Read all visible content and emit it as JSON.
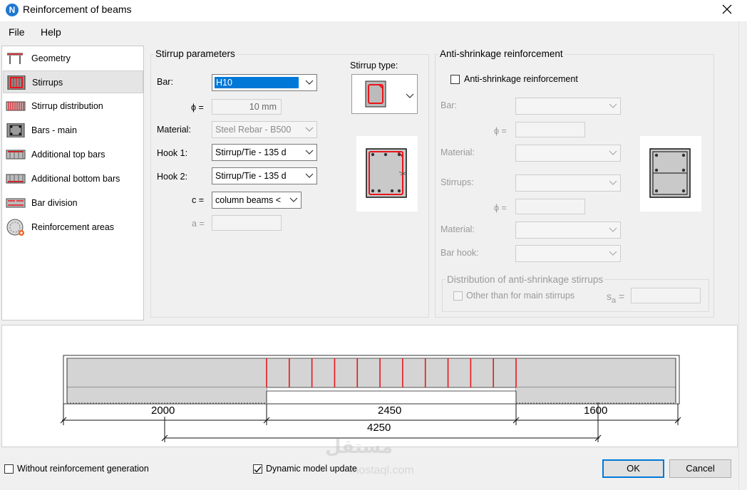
{
  "window": {
    "title": "Reinforcement of beams",
    "app_icon_letter": "N"
  },
  "menu": {
    "file": "File",
    "help": "Help"
  },
  "nav": [
    {
      "label": "Geometry",
      "icon": "geometry-icon"
    },
    {
      "label": "Stirrups",
      "icon": "stirrups-icon",
      "selected": true
    },
    {
      "label": "Stirrup distribution",
      "icon": "stirrup-distribution-icon"
    },
    {
      "label": "Bars - main",
      "icon": "bars-main-icon"
    },
    {
      "label": "Additional top bars",
      "icon": "additional-top-bars-icon"
    },
    {
      "label": "Additional bottom bars",
      "icon": "additional-bottom-bars-icon"
    },
    {
      "label": "Bar division",
      "icon": "bar-division-icon"
    },
    {
      "label": "Reinforcement areas",
      "icon": "reinforcement-areas-icon"
    }
  ],
  "stirrup": {
    "group_title": "Stirrup parameters",
    "bar_label": "Bar:",
    "bar_value": "H10",
    "phi_label": "ϕ =",
    "phi_value": "10 mm",
    "material_label": "Material:",
    "material_value": "Steel Rebar - B500",
    "hook1_label": "Hook 1:",
    "hook1_value": "Stirrup/Tie  - 135 d",
    "hook2_label": "Hook 2:",
    "hook2_value": "Stirrup/Tie  - 135 d",
    "c_label": "c =",
    "c_value": "column  beams <",
    "a_label": "a =",
    "a_value": "",
    "type_label": "Stirrup type:"
  },
  "anti": {
    "group_title": "Anti-shrinkage reinforcement",
    "checkbox_label": "Anti-shrinkage reinforcement",
    "bar_label": "Bar:",
    "phi1_label": "ϕ =",
    "material1_label": "Material:",
    "stirrups_label": "Stirrups:",
    "phi2_label": "ϕ =",
    "material2_label": "Material:",
    "hook_label": "Bar hook:",
    "dist_title": "Distribution of anti-shrinkage stirrups",
    "other_label": "Other than for main stirrups",
    "sa_label": "s",
    "sa_sub": "a",
    "sa_eq": "="
  },
  "beam": {
    "dims": [
      "2000",
      "2450",
      "1600"
    ],
    "total": "4250",
    "stirrup_count": 12,
    "colors": {
      "stirrup": "#e8151b",
      "concrete": "#d4d4d4"
    }
  },
  "footer": {
    "without_label": "Without reinforcement generation",
    "dynamic_label": "Dynamic model update",
    "dynamic_checked": true,
    "ok": "OK",
    "cancel": "Cancel"
  },
  "watermark": {
    "text": "مستقل",
    "sub": "mostaql.com"
  }
}
